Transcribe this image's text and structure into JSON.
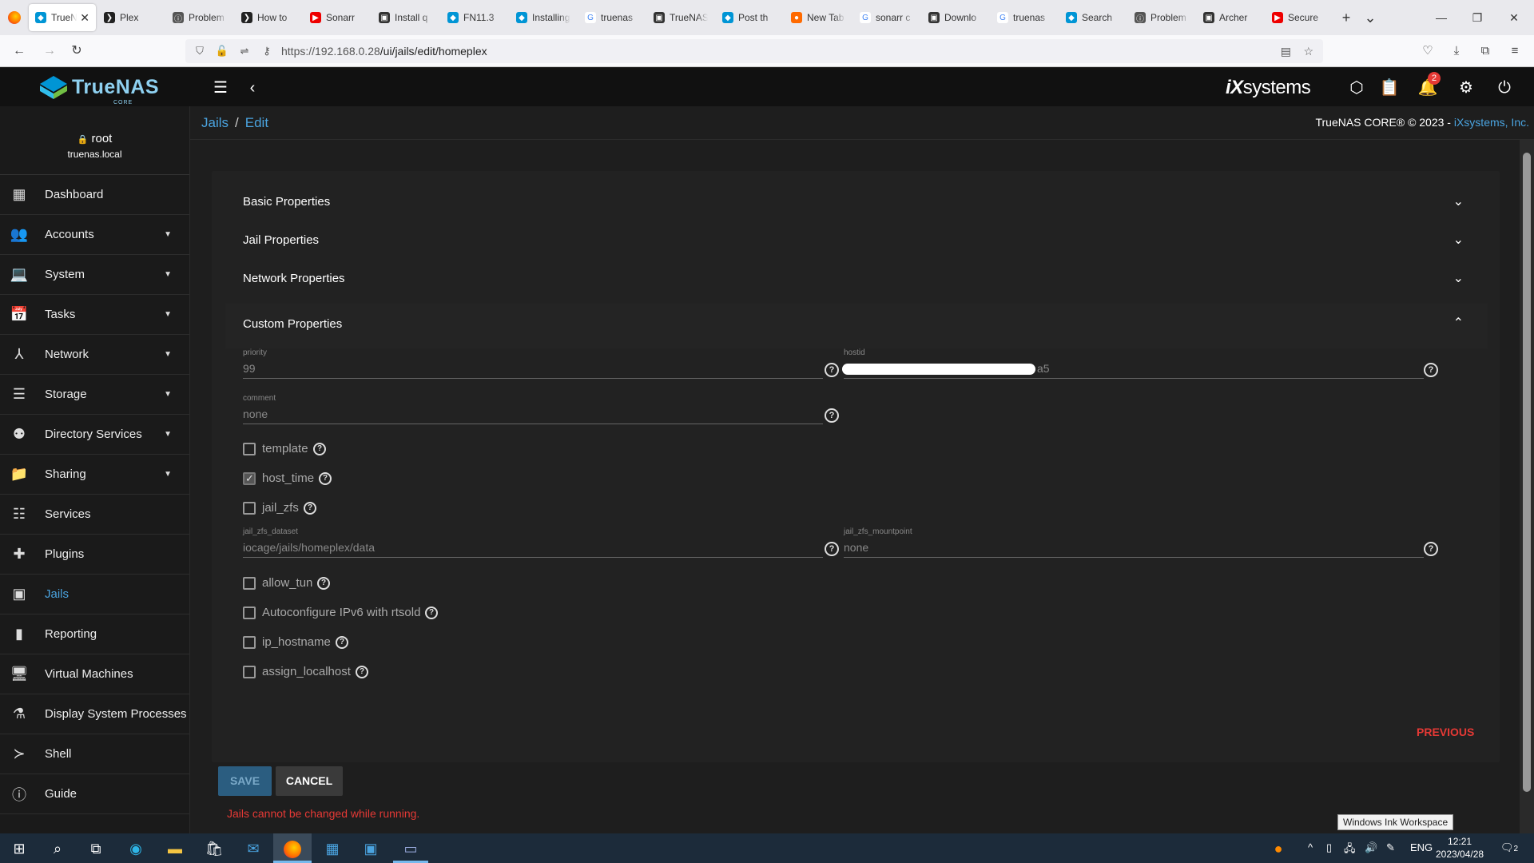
{
  "browser": {
    "tabs": [
      {
        "label": "TrueNAS",
        "icon": "truenas-icon",
        "active": true
      },
      {
        "label": "Plex",
        "icon": "plex-icon"
      },
      {
        "label": "Problem",
        "icon": "info-icon"
      },
      {
        "label": "How to",
        "icon": "plex-icon"
      },
      {
        "label": "Sonarr",
        "icon": "youtube-icon"
      },
      {
        "label": "Install q",
        "icon": "site-icon"
      },
      {
        "label": "FN11.3",
        "icon": "truenas-icon"
      },
      {
        "label": "Installing",
        "icon": "truenas-icon"
      },
      {
        "label": "truenas",
        "icon": "google-icon"
      },
      {
        "label": "TrueNAS",
        "icon": "site-icon"
      },
      {
        "label": "Post th",
        "icon": "truenas-icon"
      },
      {
        "label": "New Tab",
        "icon": "firefox-icon"
      },
      {
        "label": "sonarr c",
        "icon": "google-icon"
      },
      {
        "label": "Downlo",
        "icon": "site-icon"
      },
      {
        "label": "truenas",
        "icon": "google-icon"
      },
      {
        "label": "Search",
        "icon": "truenas-icon"
      },
      {
        "label": "Problem",
        "icon": "info-icon"
      },
      {
        "label": "Archer",
        "icon": "site-icon"
      },
      {
        "label": "Secure",
        "icon": "youtube-icon"
      }
    ],
    "url_host": "https://192.168.0.28",
    "url_path": "/ui/jails/edit/homeplex"
  },
  "header": {
    "logo": "TrueNAS",
    "logo_sub": "CORE",
    "ix_logo_i": "iX",
    "ix_logo_rest": "systems",
    "notification_count": "2"
  },
  "sidebar": {
    "user": "root",
    "hostname": "truenas.local",
    "items": [
      {
        "label": "Dashboard",
        "icon": "dashboard-icon",
        "caret": false
      },
      {
        "label": "Accounts",
        "icon": "accounts-icon",
        "caret": true
      },
      {
        "label": "System",
        "icon": "system-icon",
        "caret": true
      },
      {
        "label": "Tasks",
        "icon": "tasks-icon",
        "caret": true
      },
      {
        "label": "Network",
        "icon": "network-icon",
        "caret": true
      },
      {
        "label": "Storage",
        "icon": "storage-icon",
        "caret": true
      },
      {
        "label": "Directory Services",
        "icon": "directory-icon",
        "caret": true
      },
      {
        "label": "Sharing",
        "icon": "sharing-icon",
        "caret": true
      },
      {
        "label": "Services",
        "icon": "services-icon",
        "caret": false
      },
      {
        "label": "Plugins",
        "icon": "plugins-icon",
        "caret": false
      },
      {
        "label": "Jails",
        "icon": "jails-icon",
        "caret": false,
        "active": true
      },
      {
        "label": "Reporting",
        "icon": "reporting-icon",
        "caret": false
      },
      {
        "label": "Virtual Machines",
        "icon": "vm-icon",
        "caret": false
      },
      {
        "label": "Display System Processes",
        "icon": "processes-icon",
        "caret": false
      },
      {
        "label": "Shell",
        "icon": "shell-icon",
        "caret": false
      },
      {
        "label": "Guide",
        "icon": "guide-icon",
        "caret": false
      }
    ]
  },
  "breadcrumb": {
    "root": "Jails",
    "current": "Edit",
    "separator": "/"
  },
  "copyright": {
    "text": "TrueNAS CORE® © 2023 - ",
    "link": "iXsystems, Inc."
  },
  "sections": {
    "basic": "Basic Properties",
    "jail": "Jail Properties",
    "network": "Network Properties",
    "custom": "Custom Properties"
  },
  "custom": {
    "priority_label": "priority",
    "priority_value": "99",
    "hostid_label": "hostid",
    "hostid_value": "a5",
    "comment_label": "comment",
    "comment_value": "none",
    "checkboxes_top": [
      {
        "label": "template",
        "checked": false
      },
      {
        "label": "host_time",
        "checked": true
      },
      {
        "label": "jail_zfs",
        "checked": false
      }
    ],
    "jail_zfs_dataset_label": "jail_zfs_dataset",
    "jail_zfs_dataset_value": "iocage/jails/homeplex/data",
    "jail_zfs_mountpoint_label": "jail_zfs_mountpoint",
    "jail_zfs_mountpoint_value": "none",
    "checkboxes_bottom": [
      {
        "label": "allow_tun",
        "checked": false
      },
      {
        "label": "Autoconfigure IPv6 with rtsold",
        "checked": false
      },
      {
        "label": "ip_hostname",
        "checked": false
      },
      {
        "label": "assign_localhost",
        "checked": false
      }
    ]
  },
  "actions": {
    "previous": "PREVIOUS",
    "save": "SAVE",
    "cancel": "CANCEL",
    "error": "Jails cannot be changed while running."
  },
  "tooltip": "Windows Ink Workspace",
  "taskbar": {
    "language": "ENG",
    "time": "12:21",
    "date": "2023/04/28",
    "notification_count": "2"
  }
}
